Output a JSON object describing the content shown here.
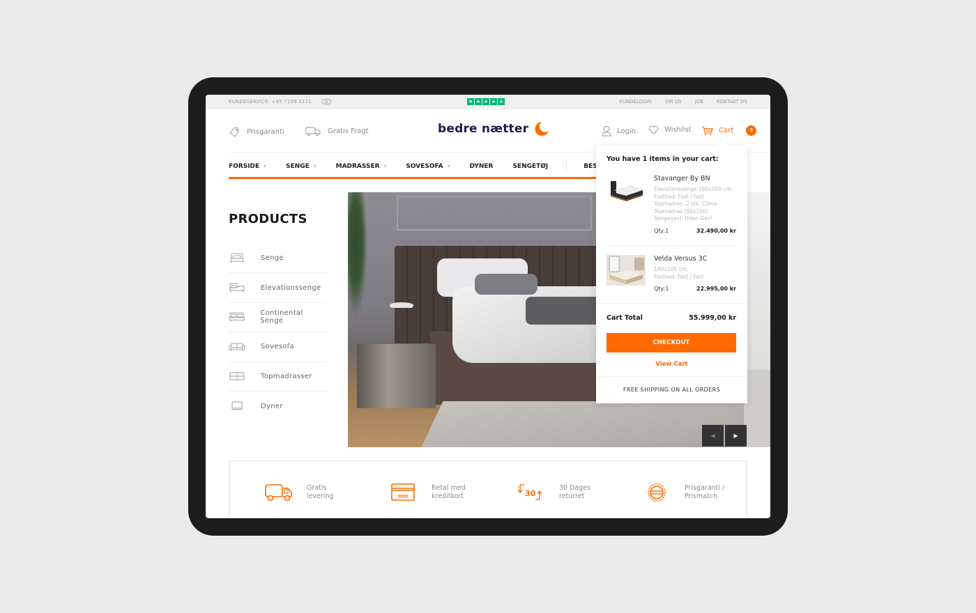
{
  "topbar": {
    "customer_service": "KUNDESERVICE: +45 7199 3171",
    "rating_stars": 5,
    "links": [
      "KUNDELOGIN",
      "OM OS",
      "JOB",
      "KONTAKT OS"
    ]
  },
  "header": {
    "perks": [
      {
        "icon": "price-tag-icon",
        "label": "Prisgaranti"
      },
      {
        "icon": "delivery-truck-icon",
        "label": "Gratis Fragt"
      }
    ],
    "logo_text": "bedre nætter",
    "login_label": "Login",
    "wishlist_label": "Wishlist",
    "cart_label": "Cart",
    "cart_count": "3"
  },
  "nav": {
    "items": [
      {
        "label": "FORSIDE",
        "dropdown": true
      },
      {
        "label": "SENGE",
        "dropdown": true
      },
      {
        "label": "MADRASSER",
        "dropdown": true
      },
      {
        "label": "SOVESOFA",
        "dropdown": true
      },
      {
        "label": "DYNER",
        "dropdown": false
      },
      {
        "label": "SENGETØJ",
        "dropdown": false
      },
      {
        "label": "BES",
        "dropdown": false
      }
    ]
  },
  "products": {
    "title": "PRODUCTS",
    "items": [
      {
        "label": "Senge",
        "icon": "bed-icon"
      },
      {
        "label": "Elevationssenge",
        "icon": "adjustable-bed-icon"
      },
      {
        "label": "Continental Senge",
        "icon": "continental-bed-icon"
      },
      {
        "label": "Sovesofa",
        "icon": "sofa-bed-icon"
      },
      {
        "label": "Topmadrasser",
        "icon": "mattress-topper-icon"
      },
      {
        "label": "Dyner",
        "icon": "duvet-icon"
      }
    ]
  },
  "hero": {
    "prev_label": "◀",
    "next_label": "▶"
  },
  "cart": {
    "heading": "You have 1 items in your cart:",
    "items": [
      {
        "name": "Stavanger By BN",
        "details": [
          "Elevationssenge 180x200 cm.",
          "Fosthed: Fast / Fast",
          "Topmadras: 2 stk. Clima Topmadras (90x200)",
          "Sengegavl: Uden Gavl"
        ],
        "qty": "Qty:1",
        "price": "32.490,00 kr"
      },
      {
        "name": "Velda Versus 3C",
        "details": [
          "180x200 cm.",
          "Fasthed: Fast / Fast"
        ],
        "qty": "Qty:1",
        "price": "22.995,00 kr"
      }
    ],
    "total_label": "Cart Total",
    "total_value": "55.999,00 kr",
    "checkout_label": "CHECKOUT",
    "view_cart_label": "View Cart",
    "free_shipping": "FREE SHIPPING ON ALL ORDERS"
  },
  "features": [
    {
      "icon": "truck-icon",
      "line1": "Gratis",
      "line2": "levering"
    },
    {
      "icon": "credit-card-icon",
      "line1": "Betal med",
      "line2": "kreditkort"
    },
    {
      "icon": "return-30-days-icon",
      "line1": "30 Dages",
      "line2": "returret"
    },
    {
      "icon": "price-match-seal-icon",
      "line1": "Prisgaranti /",
      "line2": "Prismatch"
    }
  ],
  "colors": {
    "accent": "#ff6a00",
    "brand_navy": "#1e1a4e",
    "trustpilot_green": "#00b67a"
  }
}
